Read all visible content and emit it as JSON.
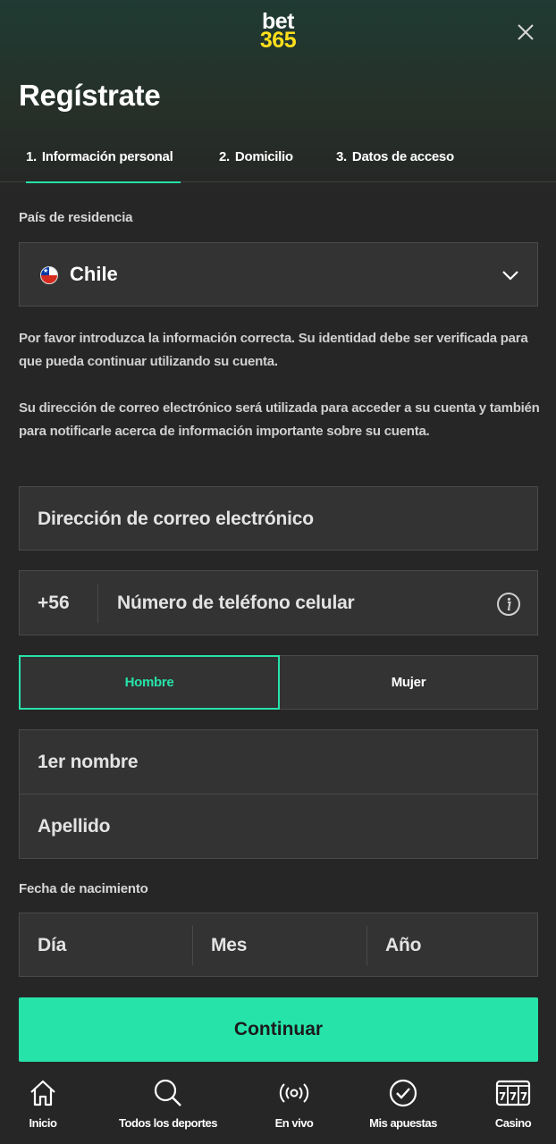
{
  "header": {
    "logo_line1": "bet",
    "logo_line2": "365",
    "title": "Regístrate"
  },
  "tabs": [
    {
      "num": "1.",
      "label": "Información personal",
      "active": true
    },
    {
      "num": "2.",
      "label": "Domicilio",
      "active": false
    },
    {
      "num": "3.",
      "label": "Datos de acceso",
      "active": false
    }
  ],
  "country": {
    "label": "País de residencia",
    "value": "Chile"
  },
  "info_text_1": "Por favor introduzca la información correcta. Su identidad debe ser verificada para que pueda continuar utilizando su cuenta.",
  "info_text_2": "Su dirección de correo electrónico será utilizada para acceder a su cuenta y también para notificarle acerca de información importante sobre su cuenta.",
  "form": {
    "email_placeholder": "Dirección de correo electrónico",
    "phone_prefix": "+56",
    "phone_placeholder": "Número de teléfono celular",
    "gender_male": "Hombre",
    "gender_female": "Mujer",
    "first_name_placeholder": "1er nombre",
    "last_name_placeholder": "Apellido",
    "dob_label": "Fecha de nacimiento",
    "day_placeholder": "Día",
    "month_placeholder": "Mes",
    "year_placeholder": "Año",
    "continue_label": "Continuar"
  },
  "nav": [
    {
      "label": "Inicio",
      "icon": "home-icon"
    },
    {
      "label": "Todos los deportes",
      "icon": "search-icon"
    },
    {
      "label": "En vivo",
      "icon": "live-icon"
    },
    {
      "label": "Mis apuestas",
      "icon": "check-circle-icon"
    },
    {
      "label": "Casino",
      "icon": "slot-machine-icon"
    }
  ],
  "colors": {
    "accent": "#26e3a9",
    "logo_yellow": "#ffdf1b",
    "background": "#262626",
    "field": "#333333"
  }
}
